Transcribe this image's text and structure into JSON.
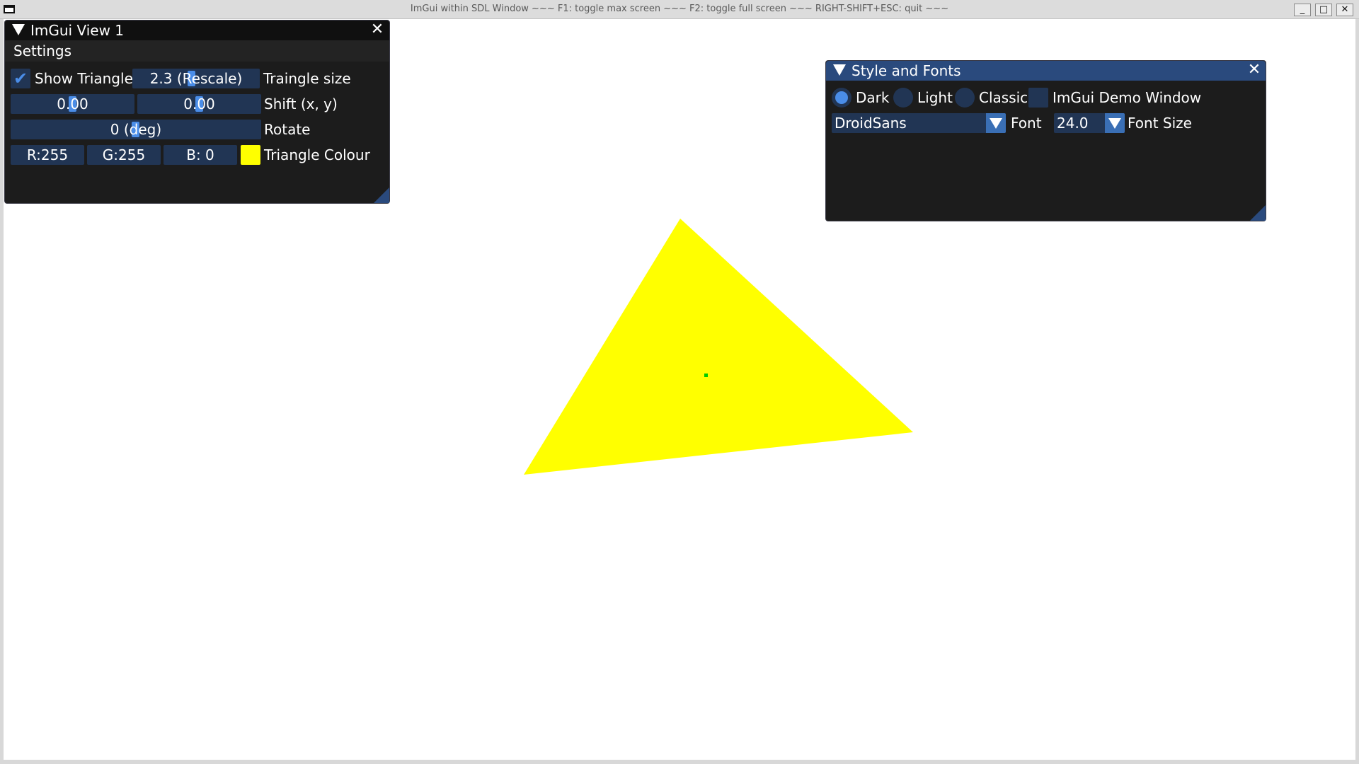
{
  "os_window": {
    "title": "ImGui within SDL Window ~~~ F1: toggle max screen ~~~ F2: toggle full screen ~~~ RIGHT-SHIFT+ESC: quit ~~~",
    "min_glyph": "_",
    "max_glyph": "□",
    "close_glyph": "✕"
  },
  "scene": {
    "triangle_colour": "#ffff00",
    "center_dot_colour": "#00cc00"
  },
  "view1": {
    "title": "ImGui View 1",
    "close_glyph": "✕",
    "menu": {
      "settings": "Settings"
    },
    "show_triangle": {
      "label": "Show Triangle",
      "checked": true,
      "check_glyph": "✔"
    },
    "triangle_size": {
      "value": "2.3 (Rescale)",
      "label": "Traingle size"
    },
    "shift": {
      "x": "0.00",
      "y": "0.00",
      "label": "Shift (x, y)"
    },
    "rotate": {
      "value": "0 (deg)",
      "label": "Rotate"
    },
    "colour": {
      "r": "R:255",
      "g": "G:255",
      "b": "B:  0",
      "label": "Triangle Colour",
      "swatch": "#ffff00"
    }
  },
  "style_fonts": {
    "title": "Style and Fonts",
    "close_glyph": "✕",
    "radios": {
      "dark": {
        "label": "Dark",
        "selected": true
      },
      "light": {
        "label": "Light",
        "selected": false
      },
      "classic": {
        "label": "Classic",
        "selected": false
      }
    },
    "demo_window": {
      "label": "ImGui Demo Window",
      "checked": false
    },
    "font": {
      "value": "DroidSans",
      "label": "Font"
    },
    "font_size": {
      "value": "24.0",
      "label": "Font Size"
    }
  },
  "colors": {
    "accent": "#4a8de8",
    "frame_bg": "#213554",
    "title_active": "#2a4a7d",
    "window_bg": "#1c1c1c"
  }
}
